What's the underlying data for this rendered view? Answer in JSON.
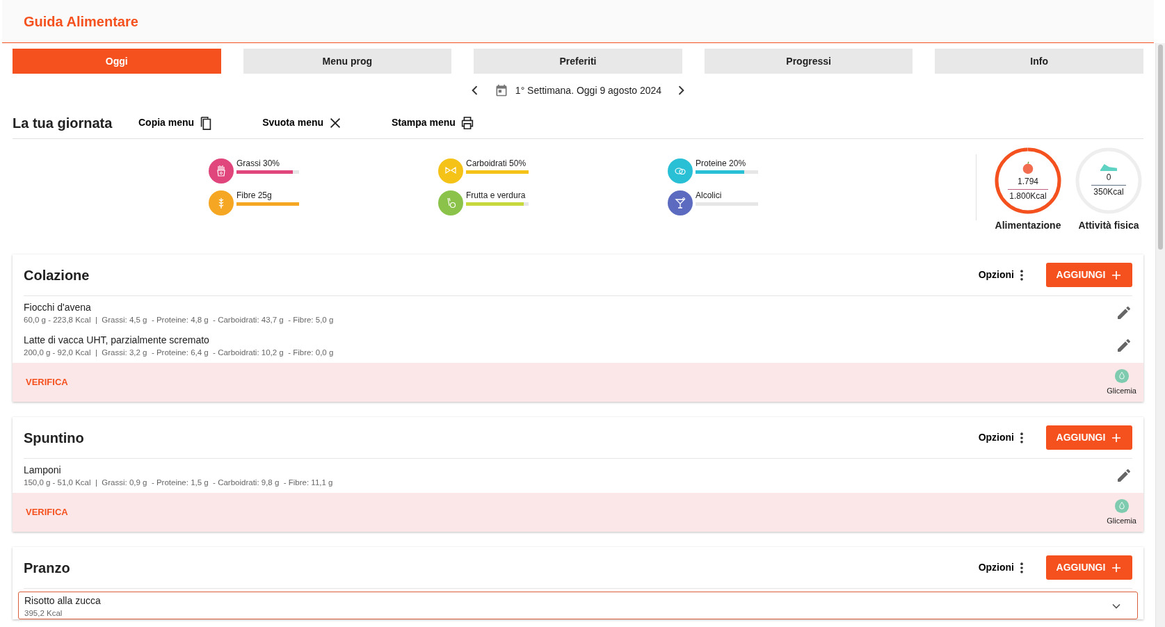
{
  "app_title": "Guida Alimentare",
  "tabs": [
    {
      "label": "Oggi",
      "selected": true
    },
    {
      "label": "Menu prog",
      "selected": false
    },
    {
      "label": "Preferiti",
      "selected": false
    },
    {
      "label": "Progressi",
      "selected": false
    },
    {
      "label": "Info",
      "selected": false
    }
  ],
  "date_nav": {
    "text": "1° Settimana. Oggi 9 agosto 2024"
  },
  "day": {
    "title": "La tua giornata",
    "actions": [
      {
        "label": "Copia menu",
        "kind": "copy"
      },
      {
        "label": "Svuota menu",
        "kind": "clear"
      },
      {
        "label": "Stampa menu",
        "kind": "print"
      }
    ]
  },
  "nutrients": [
    {
      "label": "Grassi 30%",
      "kind": "fries",
      "color": "#e0457b",
      "level": 0.9
    },
    {
      "label": "Carboidrati 50%",
      "kind": "pasta",
      "color": "#f5c218",
      "level": 1
    },
    {
      "label": "Proteine 20%",
      "kind": "eggs",
      "color": "#29c0d5",
      "level": 0.78
    },
    {
      "label": "Fibre 25g",
      "kind": "wheat",
      "color": "#f5a623",
      "level": 1
    },
    {
      "label": "Frutta e verdura",
      "kind": "veg",
      "color": "#8bc34a",
      "level": 0.92
    },
    {
      "label": "Alcolici",
      "kind": "cocktail",
      "color": "#5c6bc0",
      "level": 0
    }
  ],
  "energy": [
    {
      "kind": "food",
      "value": "1.794",
      "target": "1.800Kcal",
      "label": "Alimentazione",
      "level": 0.997
    },
    {
      "kind": "activity",
      "value": "0",
      "target": "350Kcal",
      "label": "Attività fisica"
    }
  ],
  "meals": [
    {
      "title": "Colazione",
      "options": "Opzioni",
      "add": "AGGIUNGI",
      "items": [
        {
          "kind": "food",
          "name": "Fiocchi d'avena",
          "detail": "60,0 g - 223,8 Kcal  |  Grassi: 4,5 g  - Proteine: 4,8 g  - Carboidrati: 43,7 g  - Fibre: 5,0 g"
        },
        {
          "kind": "food",
          "name": "Latte di vacca UHT, parzialmente scremato",
          "detail": "200,0 g - 92,0 Kcal  |  Grassi: 3,2 g  - Proteine: 6,4 g  - Carboidrati: 10,2 g  - Fibre: 0,0 g"
        }
      ],
      "verify": {
        "label": "VERIFICA",
        "glycemia": "Glicemia"
      }
    },
    {
      "title": "Spuntino",
      "options": "Opzioni",
      "add": "AGGIUNGI",
      "items": [
        {
          "kind": "food",
          "name": "Lamponi",
          "detail": "150,0 g - 51,0 Kcal  |  Grassi: 0,9 g  - Proteine: 1,5 g  - Carboidrati: 9,8 g  - Fibre: 11,1 g"
        }
      ],
      "verify": {
        "label": "VERIFICA",
        "glycemia": "Glicemia"
      }
    },
    {
      "title": "Pranzo",
      "options": "Opzioni",
      "add": "AGGIUNGI",
      "items": [
        {
          "kind": "recipe",
          "name": "Risotto alla zucca",
          "detail": "395,2 Kcal",
          "expanded": false
        }
      ]
    }
  ]
}
